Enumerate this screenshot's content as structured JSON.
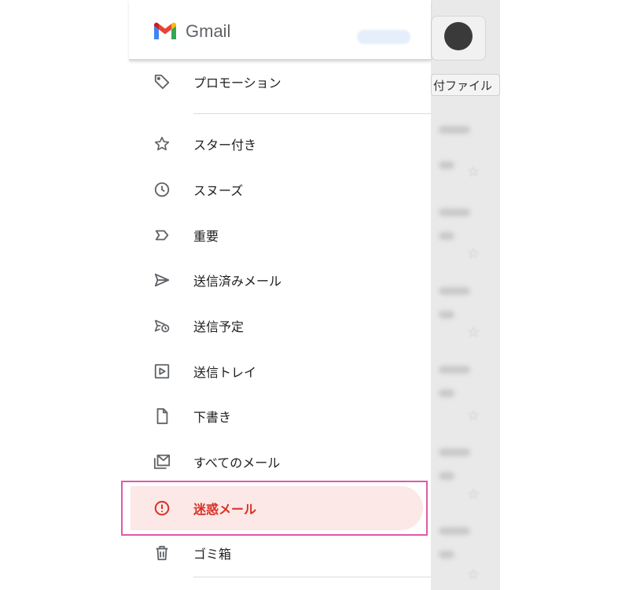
{
  "app": {
    "brand": "Gmail"
  },
  "background": {
    "attachment_chip": "付ファイル"
  },
  "drawer": {
    "items": [
      {
        "id": "promotions",
        "label": "プロモーション",
        "icon": "tag-icon"
      },
      {
        "id": "starred",
        "label": "スター付き",
        "icon": "star-icon"
      },
      {
        "id": "snoozed",
        "label": "スヌーズ",
        "icon": "clock-icon"
      },
      {
        "id": "important",
        "label": "重要",
        "icon": "important-icon"
      },
      {
        "id": "sent",
        "label": "送信済みメール",
        "icon": "send-icon"
      },
      {
        "id": "scheduled",
        "label": "送信予定",
        "icon": "scheduled-send-icon"
      },
      {
        "id": "outbox",
        "label": "送信トレイ",
        "icon": "outbox-icon"
      },
      {
        "id": "drafts",
        "label": "下書き",
        "icon": "draft-icon"
      },
      {
        "id": "all_mail",
        "label": "すべてのメール",
        "icon": "all-mail-icon"
      },
      {
        "id": "spam",
        "label": "迷惑メール",
        "icon": "spam-icon",
        "selected": true
      },
      {
        "id": "trash",
        "label": "ゴミ箱",
        "icon": "trash-icon"
      }
    ]
  },
  "colors": {
    "selected_bg": "#fce8e6",
    "selected_text": "#d93025",
    "highlight_frame": "#e05aa9"
  }
}
